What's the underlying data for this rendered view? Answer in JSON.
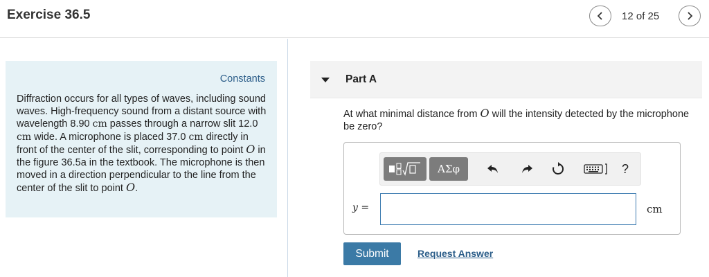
{
  "header": {
    "title": "Exercise 36.5",
    "page_count": "12 of 25"
  },
  "constants": {
    "link_label": "Constants"
  },
  "problem": {
    "t1": "Diffraction occurs for all types of waves, including sound waves. High-frequency sound from a distant source with wavelength 8.90 ",
    "u1": "cm",
    "t2": " passes through a narrow slit 12.0 ",
    "u2": "cm",
    "t3": " wide. A microphone is placed 37.0 ",
    "u3": "cm",
    "t4": " directly in front of the center of the slit, corresponding to point ",
    "p1": "O",
    "t5": " in the figure 36.5a in the textbook. The microphone is then moved in a direction perpendicular to the line from the center of the slit to point ",
    "p2": "O",
    "t6": "."
  },
  "part": {
    "title": "Part A",
    "question_a": "At what minimal distance from ",
    "question_point": "O",
    "question_b": " will the intensity detected by the microphone be zero?"
  },
  "toolbar": {
    "symbols_label": "ΑΣφ",
    "help_label": "?",
    "icons": [
      "templates-icon",
      "undo-icon",
      "redo-icon",
      "reset-icon",
      "keyboard-icon",
      "help-icon"
    ]
  },
  "answer": {
    "variable": "y",
    "equals": " =",
    "value": "",
    "unit": "cm"
  },
  "actions": {
    "submit_label": "Submit",
    "request_label": "Request Answer"
  },
  "colors": {
    "accent": "#3b7aa6",
    "link": "#2b5d89",
    "constants_bg": "#e6f2f6",
    "toolbar_button": "#7c7c7c"
  }
}
